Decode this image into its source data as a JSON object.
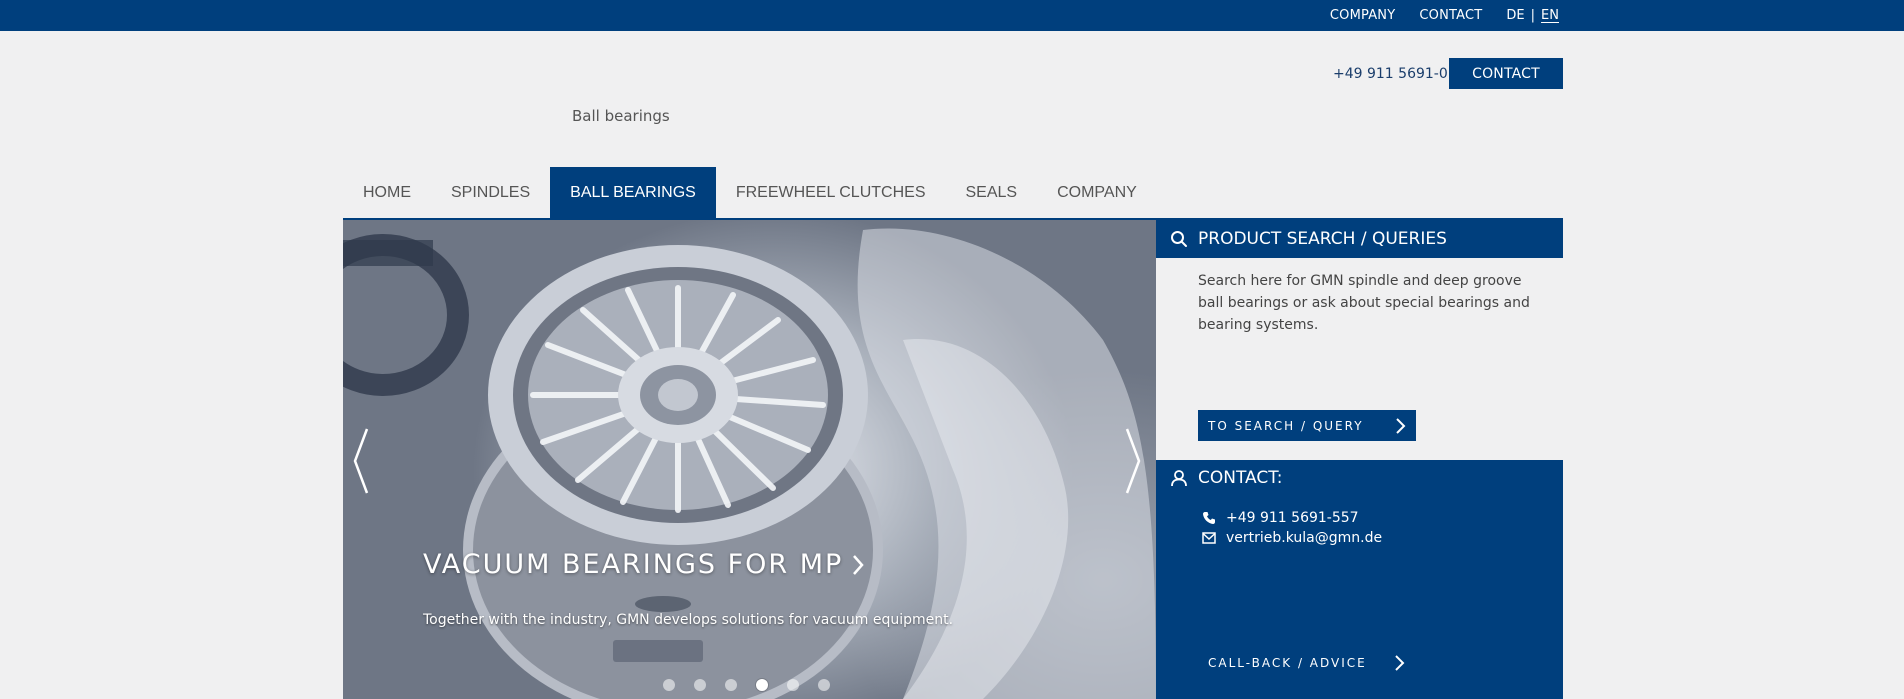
{
  "topbar": {
    "company": "COMPANY",
    "contact": "CONTACT",
    "lang_de": "DE",
    "lang_sep": "|",
    "lang_en": "EN"
  },
  "header": {
    "phone": "+49 911 5691-0",
    "contact_button": "CONTACT",
    "tagline": "Ball bearings"
  },
  "nav": {
    "items": [
      {
        "label": "HOME"
      },
      {
        "label": "SPINDLES"
      },
      {
        "label": "BALL BEARINGS",
        "active": true
      },
      {
        "label": "FREEWHEEL CLUTCHES"
      },
      {
        "label": "SEALS"
      },
      {
        "label": "COMPANY"
      }
    ]
  },
  "hero": {
    "title": "VACUUM BEARINGS FOR MP",
    "subtitle": "Together with the industry, GMN develops solutions for vacuum equipment.",
    "slide_count": 6,
    "active_slide": 4
  },
  "search_panel": {
    "title": "PRODUCT SEARCH / QUERIES",
    "text": "Search here for GMN spindle and deep groove ball bearings or ask about special bearings and bearing systems.",
    "button": "TO SEARCH / QUERY"
  },
  "contact_panel": {
    "title": "CONTACT:",
    "phone": "+49 911 5691-557",
    "email": "vertrieb.kula@gmn.de",
    "callback": "CALL-BACK / ADVICE"
  },
  "colors": {
    "brand": "#003f7d",
    "background": "#f0f0f1"
  },
  "icons": [
    "search-icon",
    "user-icon",
    "phone-icon",
    "mail-icon",
    "chevron-right-icon",
    "chevron-left-icon"
  ]
}
